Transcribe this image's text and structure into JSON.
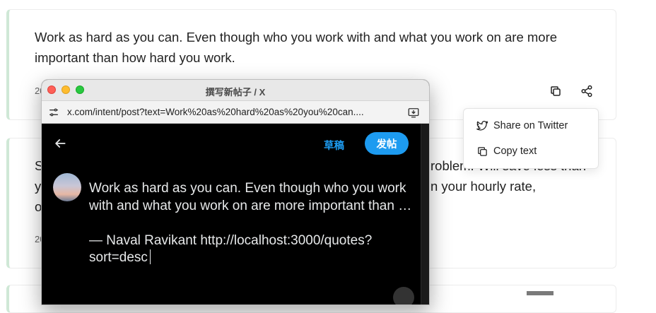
{
  "cards": [
    {
      "text": "Work as hard as you can. Even though who you work with and what you work on are more important than how hard you work.",
      "date_prefix": "20"
    },
    {
      "text_prefix_line1": "S",
      "text_suffix_line1": "roblem. Will save less than",
      "text_prefix_line2": "y",
      "text_suffix_line2": "n your hourly rate,",
      "text_prefix_line3": "o",
      "date_prefix": "20"
    }
  ],
  "share_menu": {
    "items": [
      {
        "label": "Share on Twitter",
        "icon": "twitter-icon"
      },
      {
        "label": "Copy text",
        "icon": "copy-icon"
      }
    ]
  },
  "popup": {
    "window_title": "撰写新帖子 / X",
    "url": "x.com/intent/post?text=Work%20as%20hard%20as%20you%20can....",
    "drafts_label": "草稿",
    "post_label": "发帖",
    "compose_text": "Work as hard as you can. Even though who you work with and what you work on are more important than …\n\n— Naval Ravikant http://localhost:3000/quotes?sort=desc"
  },
  "colors": {
    "accent_blue": "#1d9bf0",
    "card_border_accent": "#cfe8d6",
    "popup_bg": "#000000"
  }
}
